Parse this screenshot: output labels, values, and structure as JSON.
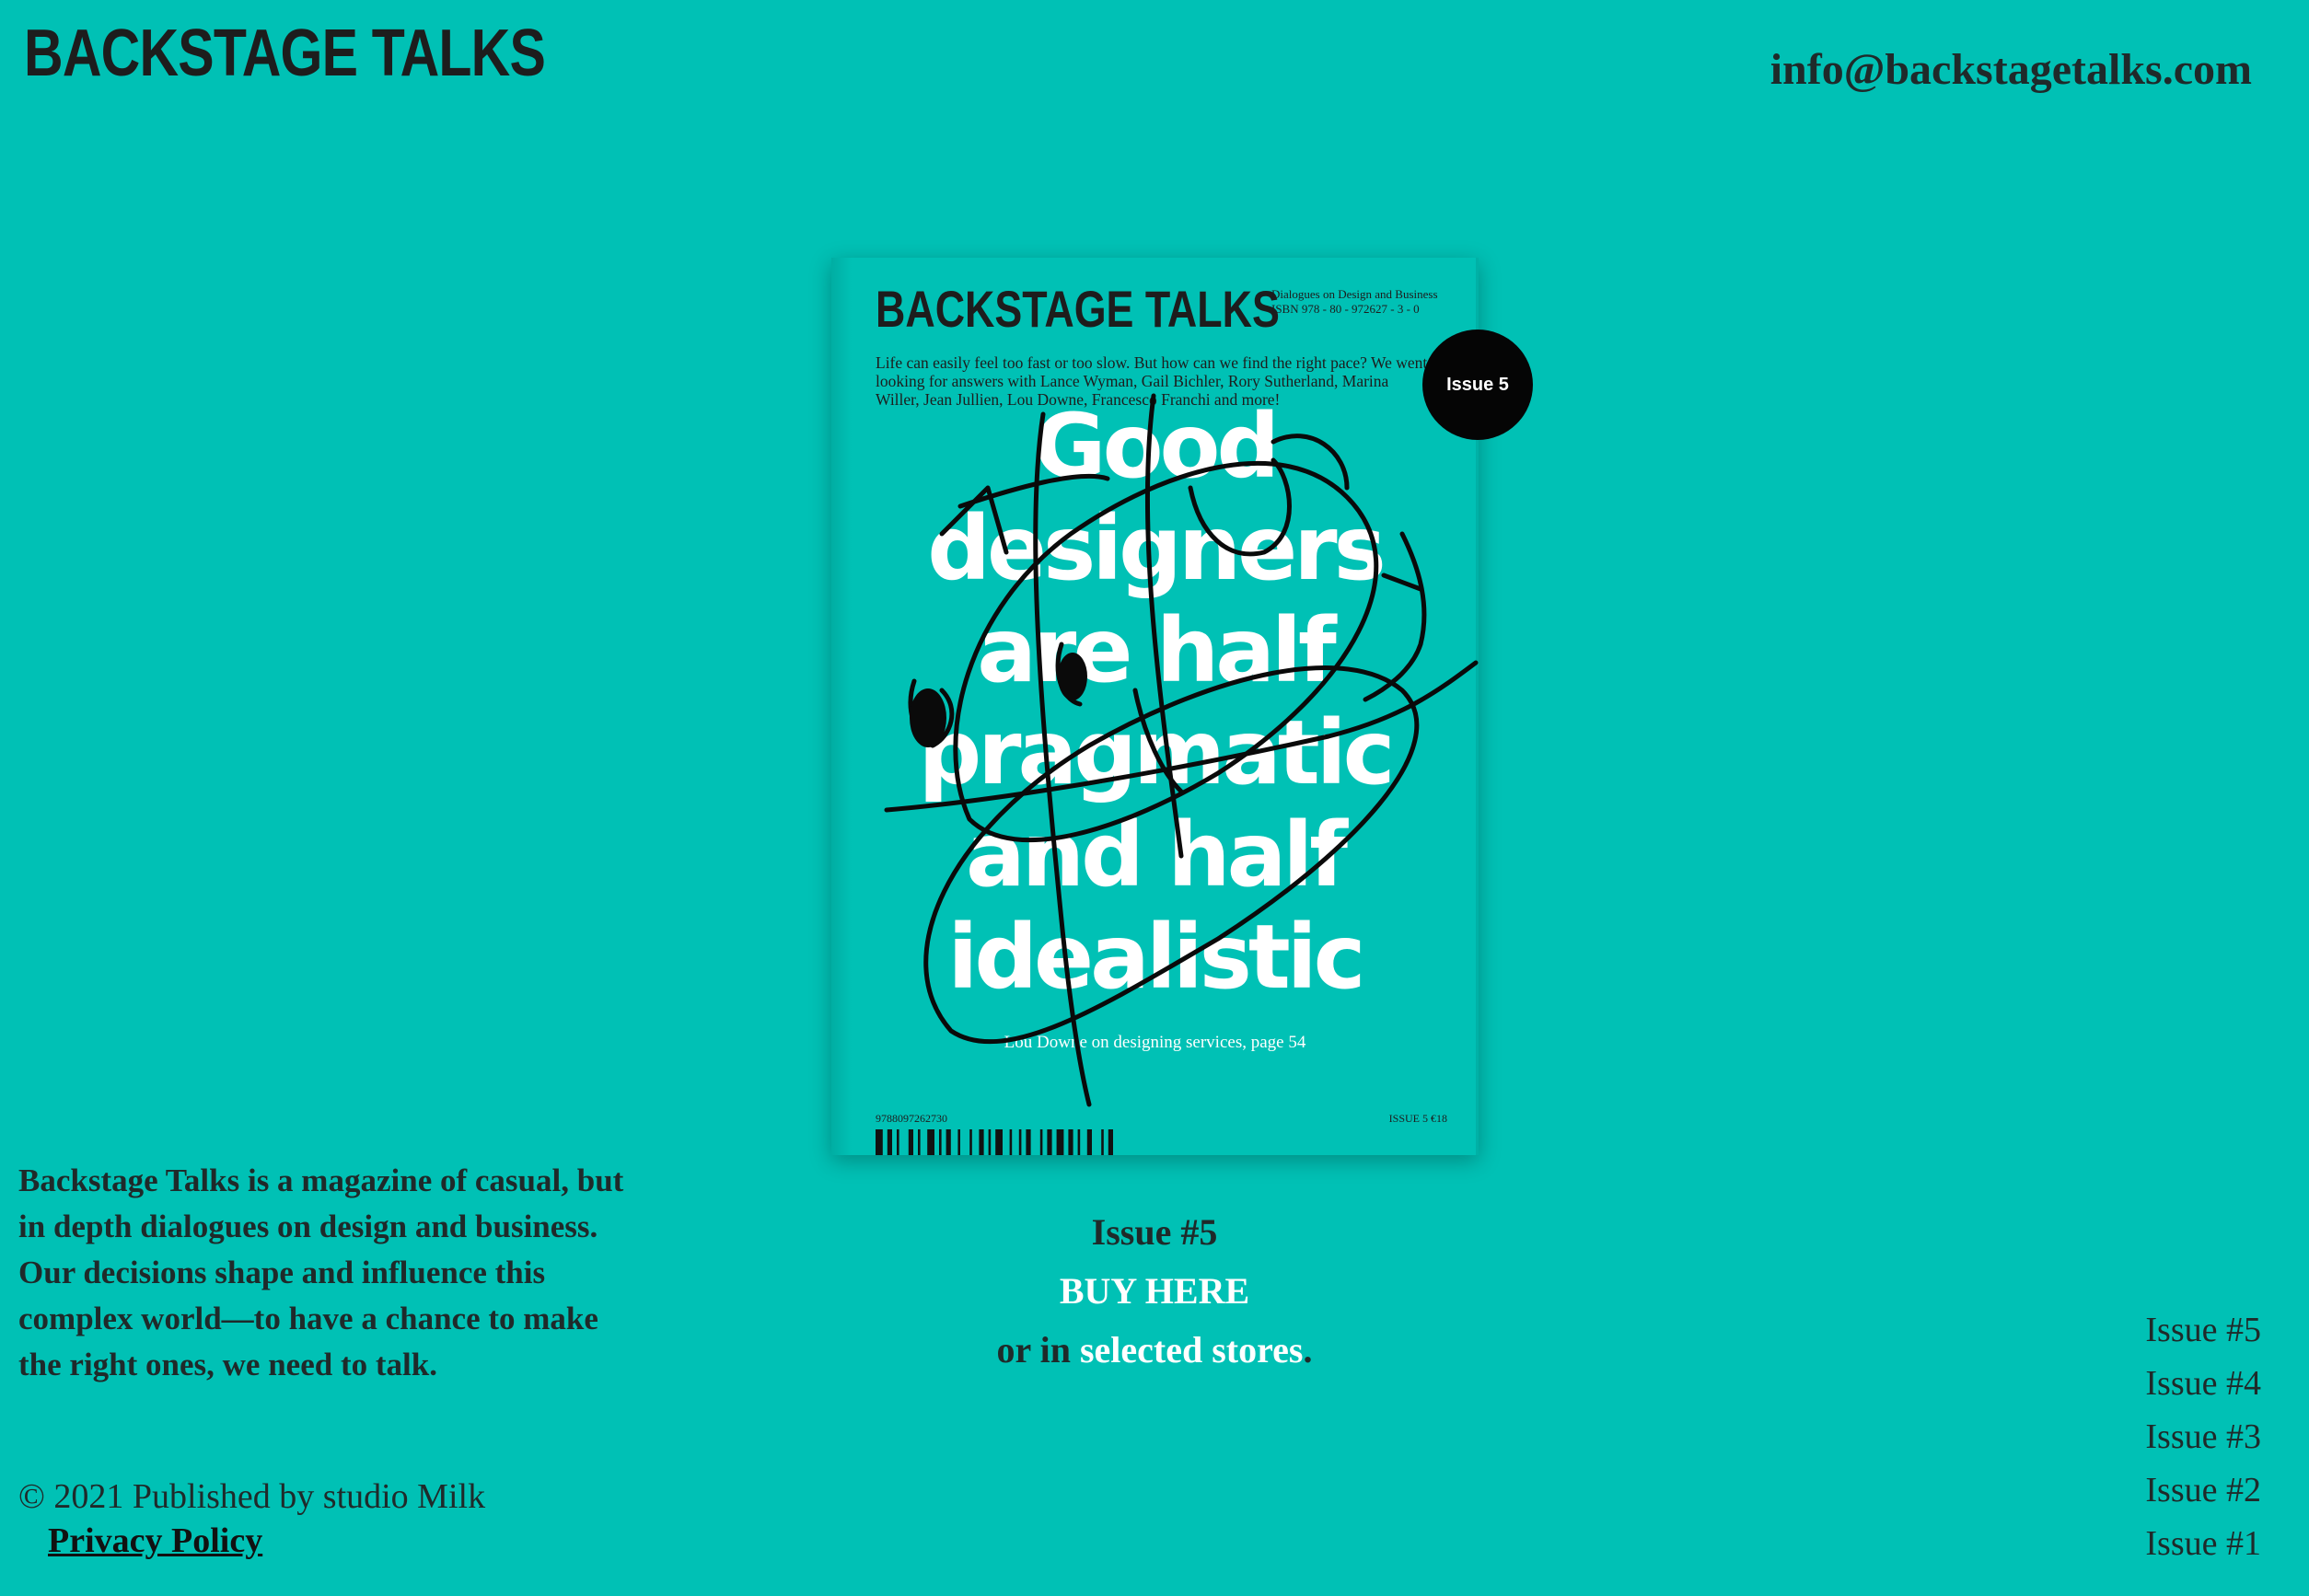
{
  "header": {
    "logo": "BACKSTAGE TALKS",
    "email": "info@backstagetalks.com"
  },
  "cover": {
    "title": "BACKSTAGE TALKS",
    "subtitle": "Dialogues on Design and Business",
    "isbn_line": "ISBN 978 - 80 - 972627 - 3 - 0",
    "intro": "Life can easily feel too fast or too slow. But how can we find the right pace? We went looking for answers with Lance Wyman, Gail Bichler, Rory Sutherland, Marina Willer, Jean Jullien, Lou Downe, Francesco Franchi and more!",
    "badge": "Issue 5",
    "headline_lines": [
      "Good",
      "designers",
      "are half",
      "pragmatic",
      "and half",
      "idealistic"
    ],
    "credit": "Lou Downe on designing services, page 54",
    "barcode_number": "9788097262730",
    "issue_price": "ISSUE 5  €18",
    "colors": {
      "background": "#00c1b5",
      "badge": "#050505",
      "headline": "#ffffff"
    }
  },
  "current_issue": {
    "label": "Issue #5",
    "buy_label": "BUY HERE",
    "stores_prefix": "or in ",
    "stores_link": "selected stores",
    "stores_suffix": "."
  },
  "about": {
    "text": "Backstage Talks is a magazine of casual, but in depth dialogues on design and business. Our decisions shape and influence this complex world—to have a chance to make the right ones, we need to talk.",
    "copyright": "© 2021 Published by studio Milk",
    "privacy": "Privacy Policy"
  },
  "issue_nav": [
    "Issue #5",
    "Issue #4",
    "Issue #3",
    "Issue #2",
    "Issue #1"
  ],
  "theme": {
    "page_background": "#00c1b5",
    "link_color": "#ffffff",
    "text_color": "#1f2a2a"
  }
}
